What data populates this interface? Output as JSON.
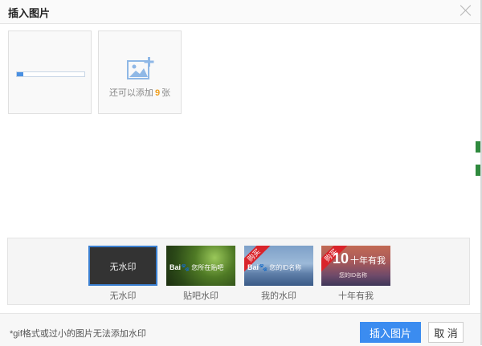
{
  "dialog": {
    "title": "插入图片",
    "close_icon": "close-icon"
  },
  "upload": {
    "progress": 0.1,
    "add_icon": "add-image-icon",
    "add_prefix": "还可以添加",
    "add_count": "9",
    "add_suffix": "张"
  },
  "watermarks": [
    {
      "label": "无水印",
      "image_text": "无水印",
      "selected": true
    },
    {
      "label": "贴吧水印",
      "image_text": "您所在贴吧"
    },
    {
      "label": "我的水印",
      "image_text": "您的ID名称",
      "ribbon": "购买"
    },
    {
      "label": "十年有我",
      "image_text": "您的ID名称",
      "ribbon": "购买"
    }
  ],
  "footer": {
    "note": "*gif格式或过小的图片无法添加水印",
    "insert_label": "插入图片",
    "cancel_label": "取 消"
  },
  "colors": {
    "accent": "#3b8cf0",
    "count": "#f0a020",
    "ribbon": "#d9242b"
  }
}
